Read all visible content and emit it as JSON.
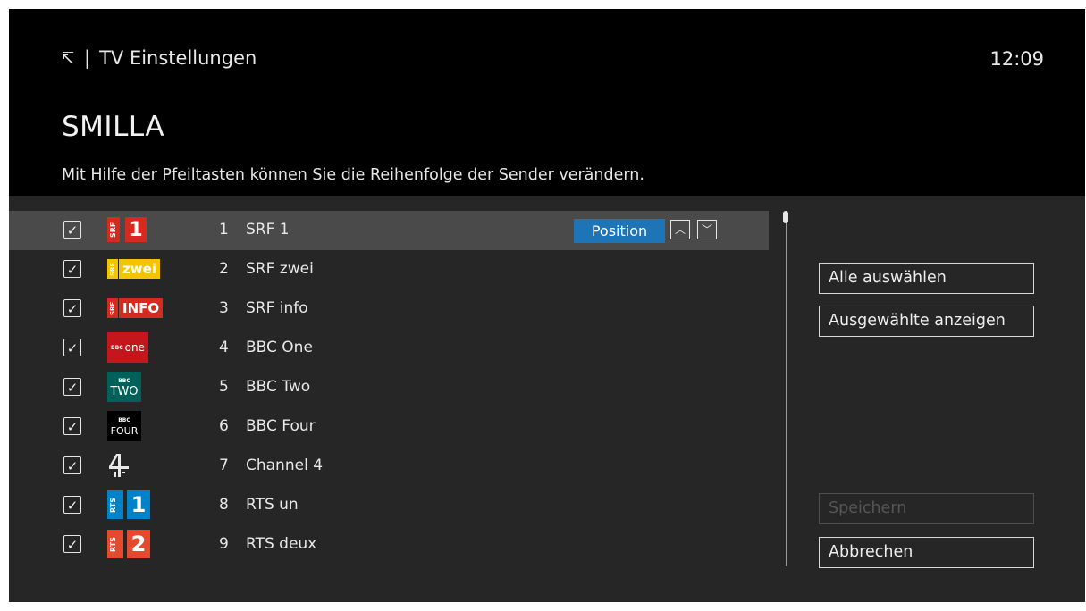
{
  "header": {
    "back_icon": "↸",
    "separator": "|",
    "section": "TV Einstellungen",
    "clock": "12:09",
    "profile_name": "SMILLA",
    "hint": "Mit Hilfe der Pfeiltasten können Sie die Reihenfolge der Sender verändern."
  },
  "channels": [
    {
      "num": "1",
      "name": "SRF 1",
      "checked": "✓",
      "logo": "srf1"
    },
    {
      "num": "2",
      "name": "SRF zwei",
      "checked": "✓",
      "logo": "srfzwei"
    },
    {
      "num": "3",
      "name": "SRF info",
      "checked": "✓",
      "logo": "srfinfo"
    },
    {
      "num": "4",
      "name": "BBC One",
      "checked": "✓",
      "logo": "bbcone"
    },
    {
      "num": "5",
      "name": "BBC Two",
      "checked": "✓",
      "logo": "bbctwo"
    },
    {
      "num": "6",
      "name": "BBC Four",
      "checked": "✓",
      "logo": "bbcfour"
    },
    {
      "num": "7",
      "name": "Channel 4",
      "checked": "✓",
      "logo": "channel4"
    },
    {
      "num": "8",
      "name": "RTS un",
      "checked": "✓",
      "logo": "rts1"
    },
    {
      "num": "9",
      "name": "RTS deux",
      "checked": "✓",
      "logo": "rts2"
    }
  ],
  "logos": {
    "srf1_tag": "SRF",
    "srf1_text": "1",
    "srfzwei_tag": "SRF",
    "srfzwei_text": "zwei",
    "srfinfo_tag": "SRF",
    "srfinfo_text": "INFO",
    "bbcone_tag": "BBC",
    "bbcone_text": "one",
    "bbctwo_tag": "BBC",
    "bbctwo_text": "TWO",
    "bbcfour_tag": "BBC",
    "bbcfour_text": "FOUR",
    "rts1_tag": "RTS",
    "rts1_text": "1",
    "rts2_tag": "RTS",
    "rts2_text": "2"
  },
  "selected_row": {
    "position_label": "Position",
    "up_icon": "︿",
    "down_icon": "﹀"
  },
  "buttons": {
    "select_all": "Alle auswählen",
    "show_selected": "Ausgewählte anzeigen",
    "save": "Speichern",
    "cancel": "Abbrechen"
  },
  "colors": {
    "accent": "#1d75b7",
    "srf_red": "#d52b1e",
    "srf_yellow": "#f5c400",
    "bbc_one_red": "#c4161c",
    "bbc_two_teal": "#00615a",
    "rts_blue": "#0082c8",
    "rts_red": "#e44b2e"
  }
}
